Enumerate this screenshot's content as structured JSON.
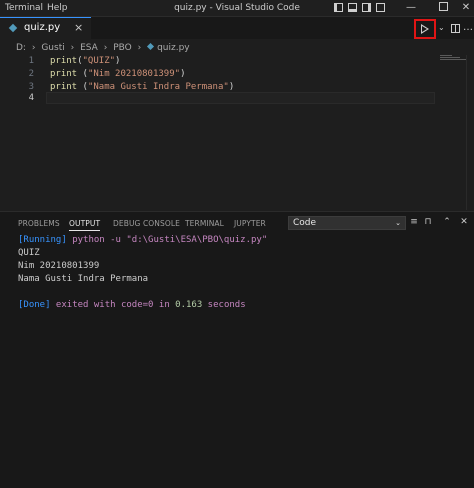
{
  "menu": [
    "Terminal",
    "Help"
  ],
  "window_title": "quiz.py - Visual Studio Code",
  "window_controls": {
    "minimize": "—",
    "close": "✕"
  },
  "tab": {
    "label": "quiz.py",
    "close": "×"
  },
  "breadcrumb": [
    "D:",
    "Gusti",
    "ESA",
    "PBO",
    "quiz.py"
  ],
  "breadcrumb_sep": "›",
  "editor": {
    "lines": [
      {
        "number": "1",
        "fn": "print",
        "open": "(",
        "str": "\"QUIZ\"",
        "close": ")"
      },
      {
        "number": "2",
        "fn": "print",
        "open": " (",
        "str": "\"Nim 20210801399\"",
        "close": ")"
      },
      {
        "number": "3",
        "fn": "print",
        "open": " (",
        "str": "\"Nama Gusti Indra Permana\"",
        "close": ")"
      },
      {
        "number": "4",
        "fn": "",
        "open": "",
        "str": "",
        "close": ""
      }
    ]
  },
  "panel": {
    "tabs": [
      "PROBLEMS",
      "OUTPUT",
      "DEBUG CONSOLE",
      "TERMINAL",
      "JUPYTER"
    ],
    "active_tab": "OUTPUT",
    "output_channel": "Code",
    "output": {
      "running_tag": "[Running]",
      "running_cmd": " python -u \"d:\\Gusti\\ESA\\PBO\\quiz.py\"",
      "lines": [
        "QUIZ",
        "Nim 20210801399",
        "Nama Gusti Indra Permana"
      ],
      "done_tag": "[Done]",
      "done_text_1": " exited with ",
      "done_code": "code=0",
      "done_text_2": " in ",
      "done_time": "0.163",
      "done_text_3": " seconds"
    }
  },
  "colors": {
    "accent": "#3794ff",
    "run_highlight": "#e01515",
    "string": "#ce9178",
    "function": "#dcdcaa"
  }
}
